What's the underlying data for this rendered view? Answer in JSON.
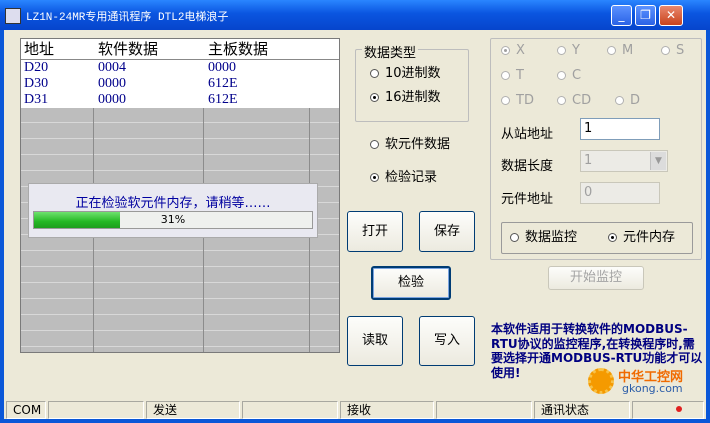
{
  "window": {
    "title": "LZ1N-24MR专用通讯程序 DTL2电梯浪子",
    "minimize_label": "_",
    "restore_label": "❐",
    "close_label": "✕"
  },
  "grid": {
    "headers": [
      "地址",
      "软件数据",
      "主板数据"
    ],
    "rows": [
      [
        "D20",
        "0004",
        "0000"
      ],
      [
        "D30",
        "0000",
        "612E"
      ],
      [
        "D31",
        "0000",
        "612E"
      ]
    ]
  },
  "progress": {
    "message": "正在检验软元件内存，请稍等……",
    "percent_label": "31%",
    "fraction": 0.31
  },
  "data_type": {
    "group_label": "数据类型",
    "options": [
      "10进制数",
      "16进制数"
    ],
    "selected": "16进制数"
  },
  "mode": {
    "options": [
      "软元件数据",
      "检验记录"
    ],
    "selected": "检验记录"
  },
  "buttons": {
    "open": "打开",
    "save": "保存",
    "verify": "检验",
    "read": "读取",
    "write": "写入",
    "start_monitor": "开始监控"
  },
  "device_types": {
    "row1": [
      "X",
      "Y",
      "M",
      "S"
    ],
    "row2": [
      "T",
      "C"
    ],
    "row3": [
      "TD",
      "CD",
      "D"
    ],
    "selected": "X"
  },
  "fields": {
    "slave_address_label": "从站地址",
    "slave_address_value": "1",
    "data_length_label": "数据长度",
    "data_length_value": "1",
    "element_address_label": "元件地址",
    "element_address_value": "0"
  },
  "monitor_mode": {
    "options": [
      "数据监控",
      "元件内存"
    ],
    "selected": "元件内存"
  },
  "note": "本软件适用于转换软件的MODBUS-RTU协议的监控程序,在转换程序时,需要选择开通MODBUS-RTU功能才可以使用!",
  "statusbar": {
    "com": "COM",
    "send": "发送",
    "receive": "接收",
    "comm_status": "通讯状态"
  },
  "watermark": {
    "brand": "中华工控网",
    "url": "gkong.com"
  },
  "colors": {
    "titlebar": "#0a55e0",
    "grid_text": "#00008b",
    "progress_fill": "#24b824",
    "note_text": "#000080",
    "status_led": "#e02020"
  }
}
